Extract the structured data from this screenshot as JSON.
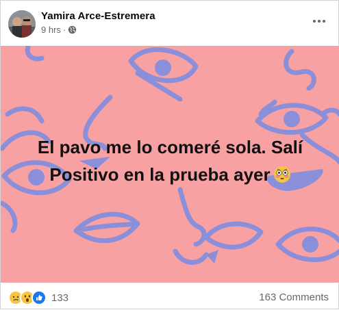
{
  "post": {
    "author": "Yamira Arce-Estremera",
    "time": "9 hrs",
    "separator": "·",
    "privacy_icon": "globe-icon",
    "more_icon": "more-options-icon"
  },
  "image": {
    "background_color": "#f8a1a2",
    "doodle_color": "#8b8fd9",
    "caption_line1": "El pavo me lo comeré sola. Salí",
    "caption_line2": "Positivo en la prueba ayer",
    "emoji_icon": "flushed-face-icon"
  },
  "footer": {
    "reaction_icons": [
      "sad-reaction-icon",
      "wow-reaction-icon",
      "like-reaction-icon"
    ],
    "reaction_count": "133",
    "comments_label": "163 Comments"
  }
}
